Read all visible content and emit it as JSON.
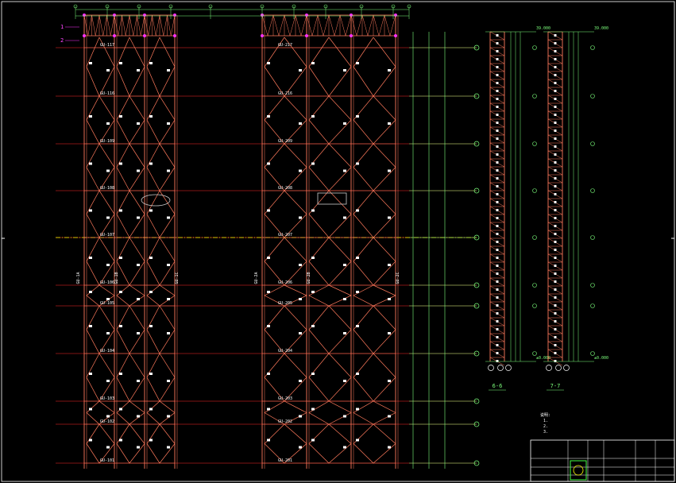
{
  "title_block": {
    "text_top_left": "",
    "plan_caption": "",
    "drawing_title": ""
  },
  "columns_left": [
    {
      "label": "GU-1A"
    },
    {
      "label": "GU-1B"
    },
    {
      "label": "GU-1C"
    }
  ],
  "columns_right": [
    {
      "label": "GU-2A"
    },
    {
      "label": "GU-2B"
    },
    {
      "label": "GU-2C"
    }
  ],
  "levels_left": [
    "GU-117",
    "GU-116",
    "GU-109",
    "GU-108",
    "GU-107",
    "GU-106",
    "GU-105",
    "GU-104",
    "GU-103",
    "GU-102",
    "GU-101"
  ],
  "levels_right": [
    "GU-217",
    "GU-216",
    "GU-209",
    "GU-208",
    "GU-207",
    "GU-206",
    "GU-205",
    "GU-204",
    "GU-203",
    "GU-202",
    "GU-201"
  ],
  "sections": [
    {
      "label": "6-6"
    },
    {
      "label": "7-7"
    }
  ],
  "elevations": {
    "top_a": "39.000",
    "top_b": "39.000",
    "bot_a": "±0.000",
    "bot_b": "±0.000"
  },
  "grid_markers": [
    "1",
    "2"
  ],
  "notes_heading": "说明:",
  "notes": [
    "1.",
    "2.",
    "3."
  ],
  "colors": {
    "background": "#000000",
    "truss": "#ff7a5c",
    "dims": "#7cff7c",
    "nodes": "#ff33ff",
    "levels": "#ff2a2a",
    "center": "#ffff00",
    "frame": "#ffffff"
  }
}
